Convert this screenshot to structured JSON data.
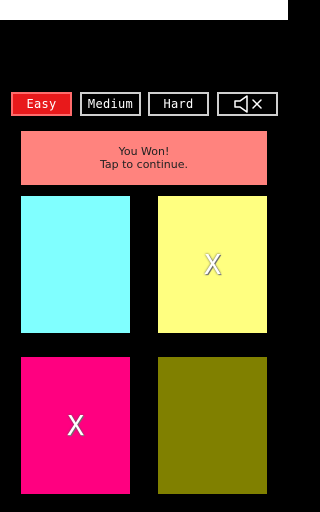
{
  "difficulty": {
    "easy_label": "Easy",
    "medium_label": "Medium",
    "hard_label": "Hard",
    "selected": "Easy"
  },
  "sound": {
    "icon": "speaker-muted-icon"
  },
  "banner": {
    "line1": "You Won!",
    "line2": "Tap to continue."
  },
  "tiles": [
    {
      "color": "#80ffff",
      "mark": ""
    },
    {
      "color": "#ffff80",
      "mark": "X"
    },
    {
      "color": "#ff0080",
      "mark": "X"
    },
    {
      "color": "#808000",
      "mark": ""
    }
  ],
  "colors": {
    "active_button": "#e8191b",
    "banner": "#ff837e",
    "background": "#000000"
  }
}
